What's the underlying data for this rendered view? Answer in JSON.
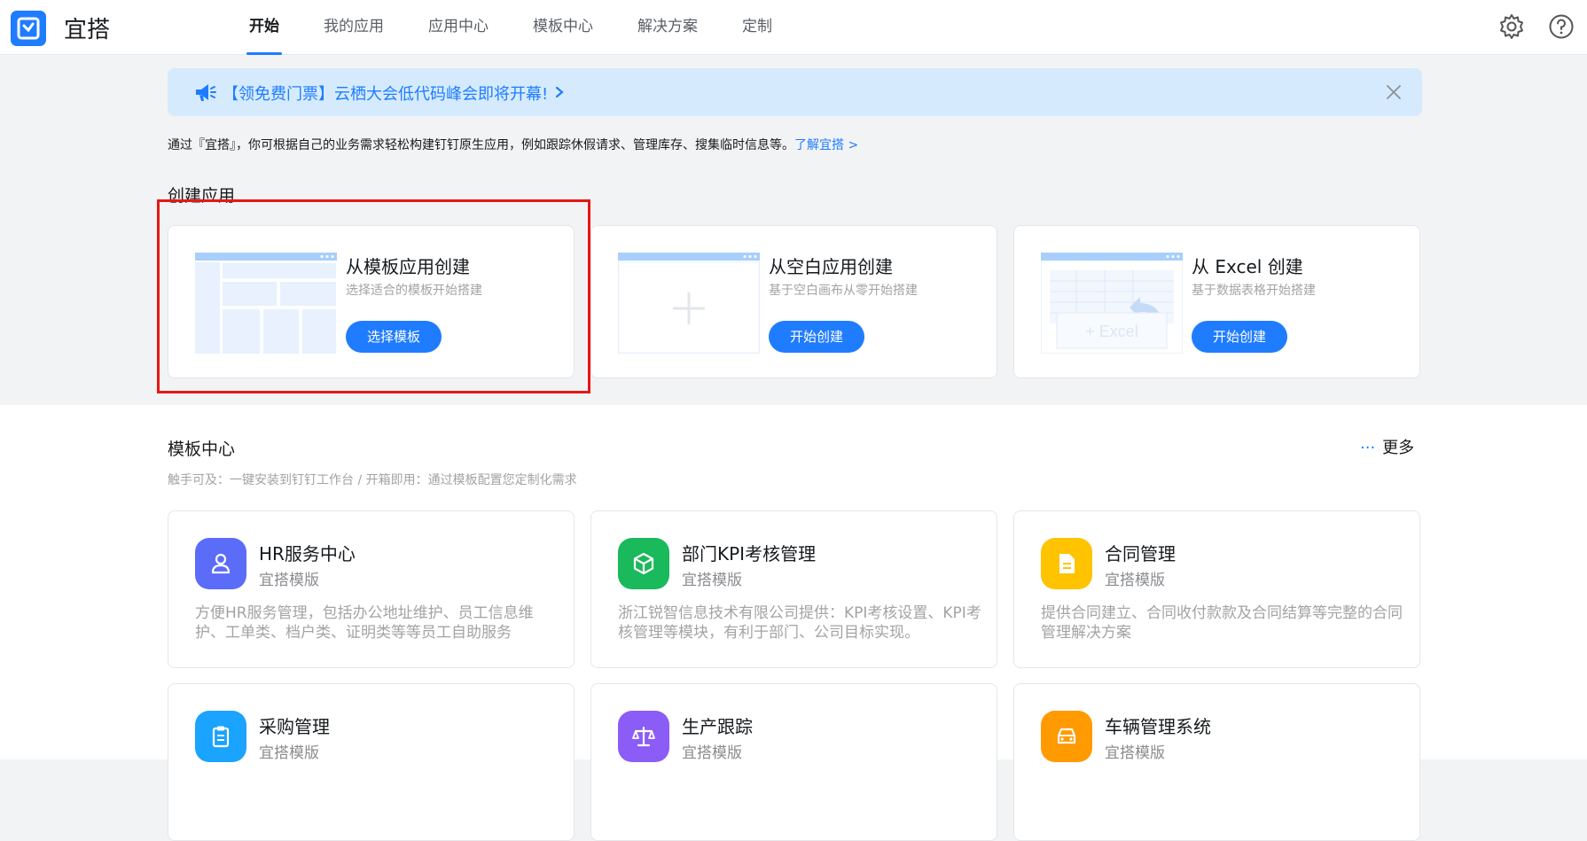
{
  "app": {
    "brand": "宜搭"
  },
  "nav": [
    "开始",
    "我的应用",
    "应用中心",
    "模板中心",
    "解决方案",
    "定制"
  ],
  "banner": {
    "text": "【领免费门票】云栖大会低代码峰会即将开幕!"
  },
  "intro": {
    "text": "通过『宜搭』，你可根据自己的业务需求轻松构建钉钉原生应用，例如跟踪休假请求、管理库存、搜集临时信息等。",
    "link": "了解宜搭 >"
  },
  "create": {
    "title": "创建应用",
    "cards": [
      {
        "title": "从模板应用创建",
        "sub": "选择适合的模板开始搭建",
        "button": "选择模板"
      },
      {
        "title": "从空白应用创建",
        "sub": "基于空白画布从零开始搭建",
        "button": "开始创建"
      },
      {
        "title": "从 Excel 创建",
        "sub": "基于数据表格开始搭建",
        "button": "开始创建",
        "thumb_text": "+ Excel"
      }
    ]
  },
  "templates": {
    "title": "模板中心",
    "more": "更多",
    "note": "触手可及：一键安装到钉钉工作台 / 开箱即用：通过模板配置您定制化需求",
    "items": [
      {
        "name": "HR服务中心",
        "tag": "宜搭模版",
        "desc": "方便HR服务管理，包括办公地址维护、员工信息维护、工单类、档户类、证明类等等员工自助服务",
        "color": "#5b6cf9",
        "icon": "user-icon"
      },
      {
        "name": "部门KPI考核管理",
        "tag": "宜搭模版",
        "desc": "浙江锐智信息技术有限公司提供：KPI考核设置、KPI考核管理等模块，有利于部门、公司目标实现。",
        "color": "#1ab95b",
        "icon": "cube-icon"
      },
      {
        "name": "合同管理",
        "tag": "宜搭模版",
        "desc": "提供合同建立、合同收付款款及合同结算等完整的合同管理解决方案",
        "color": "#ffc300",
        "icon": "document-icon"
      },
      {
        "name": "采购管理",
        "tag": "宜搭模版",
        "desc": "",
        "color": "#1aa3ff",
        "icon": "clipboard-icon"
      },
      {
        "name": "生产跟踪",
        "tag": "宜搭模版",
        "desc": "",
        "color": "#8b5cf6",
        "icon": "balance-icon"
      },
      {
        "name": "车辆管理系统",
        "tag": "宜搭模版",
        "desc": "",
        "color": "#ff9a00",
        "icon": "car-icon"
      }
    ]
  }
}
